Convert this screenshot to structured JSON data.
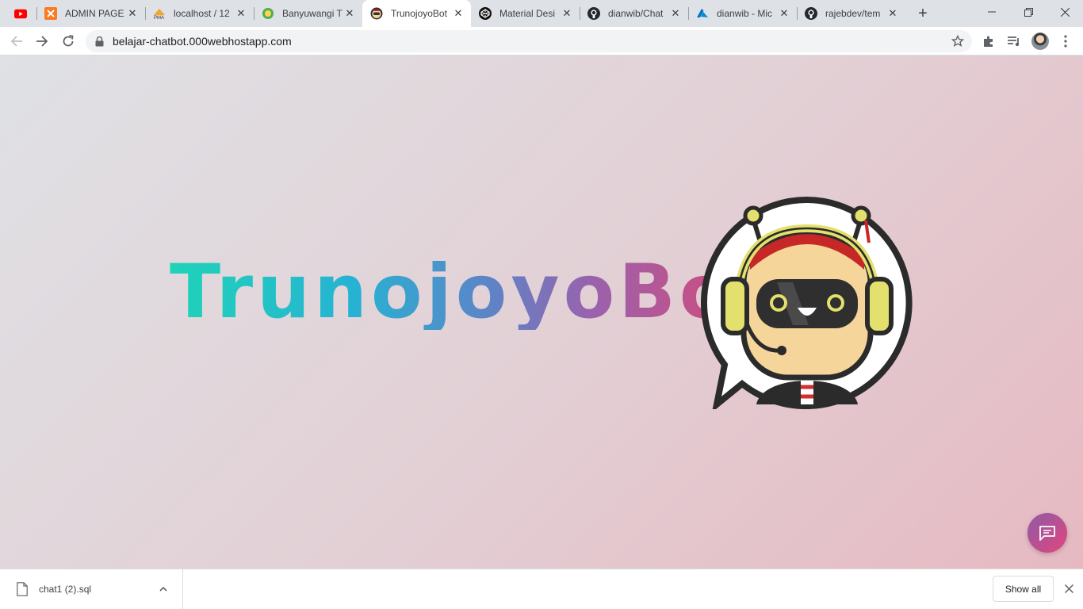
{
  "browser": {
    "tabs": [
      {
        "title": "",
        "icon": "youtube-icon"
      },
      {
        "title": "ADMIN PAGE",
        "icon": "xampp-icon"
      },
      {
        "title": "localhost / 12",
        "icon": "phpmyadmin-icon"
      },
      {
        "title": "Banyuwangi T",
        "icon": "site-logo-icon"
      },
      {
        "title": "TrunojoyoBot",
        "icon": "robot-icon",
        "active": true
      },
      {
        "title": "Material Desi",
        "icon": "codepen-icon"
      },
      {
        "title": "dianwib/Chat",
        "icon": "github-icon"
      },
      {
        "title": "dianwib - Mic",
        "icon": "azure-icon"
      },
      {
        "title": "rajebdev/tem",
        "icon": "github-icon"
      }
    ],
    "address": {
      "url": "belajar-chatbot.000webhostapp.com"
    },
    "colors": {
      "tabstrip": "#dee1e6",
      "omnibox": "#f1f3f4"
    }
  },
  "page": {
    "brand_text": "TrunojoyoBot",
    "logo_icon": "robot-headset-chat-icon",
    "fab_icon": "chat-bubble-icon",
    "colors": {
      "gradient_start": "#1fd3b8",
      "gradient_end": "#e0456f",
      "fab": "#c14f8d"
    }
  },
  "downloads": {
    "items": [
      {
        "filename": "chat1 (2).sql"
      }
    ],
    "show_all_label": "Show all"
  }
}
